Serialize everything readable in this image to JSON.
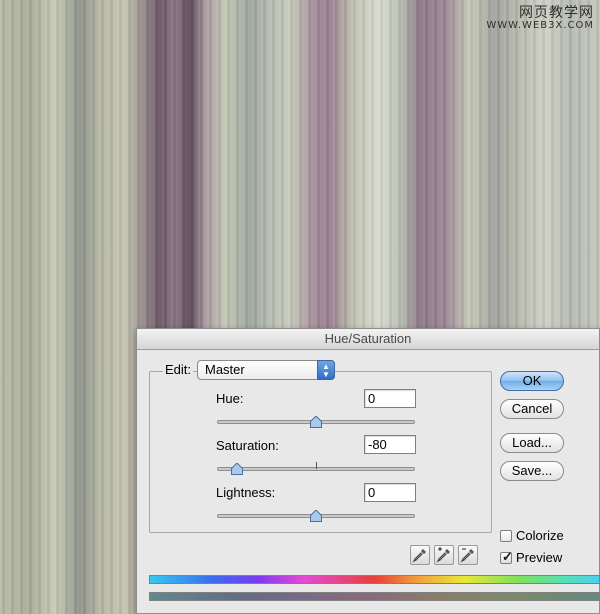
{
  "watermark": {
    "line1": "网页教学网",
    "line2": "WWW.WEB3X.COM"
  },
  "dialog": {
    "title": "Hue/Saturation",
    "edit": {
      "label": "Edit:",
      "value": "Master"
    },
    "params": [
      {
        "label": "Hue:",
        "value": "0",
        "slider_fraction": 0.5
      },
      {
        "label": "Saturation:",
        "value": "-80",
        "slider_fraction": 0.1
      },
      {
        "label": "Lightness:",
        "value": "0",
        "slider_fraction": 0.5
      }
    ],
    "buttons": {
      "ok": "OK",
      "cancel": "Cancel",
      "load": "Load...",
      "save": "Save..."
    },
    "colorize": {
      "label": "Colorize",
      "checked": false
    },
    "preview": {
      "label": "Preview",
      "checked": true
    },
    "eyedroppers": [
      "eyedropper-icon",
      "eyedropper-plus-icon",
      "eyedropper-minus-icon"
    ]
  }
}
